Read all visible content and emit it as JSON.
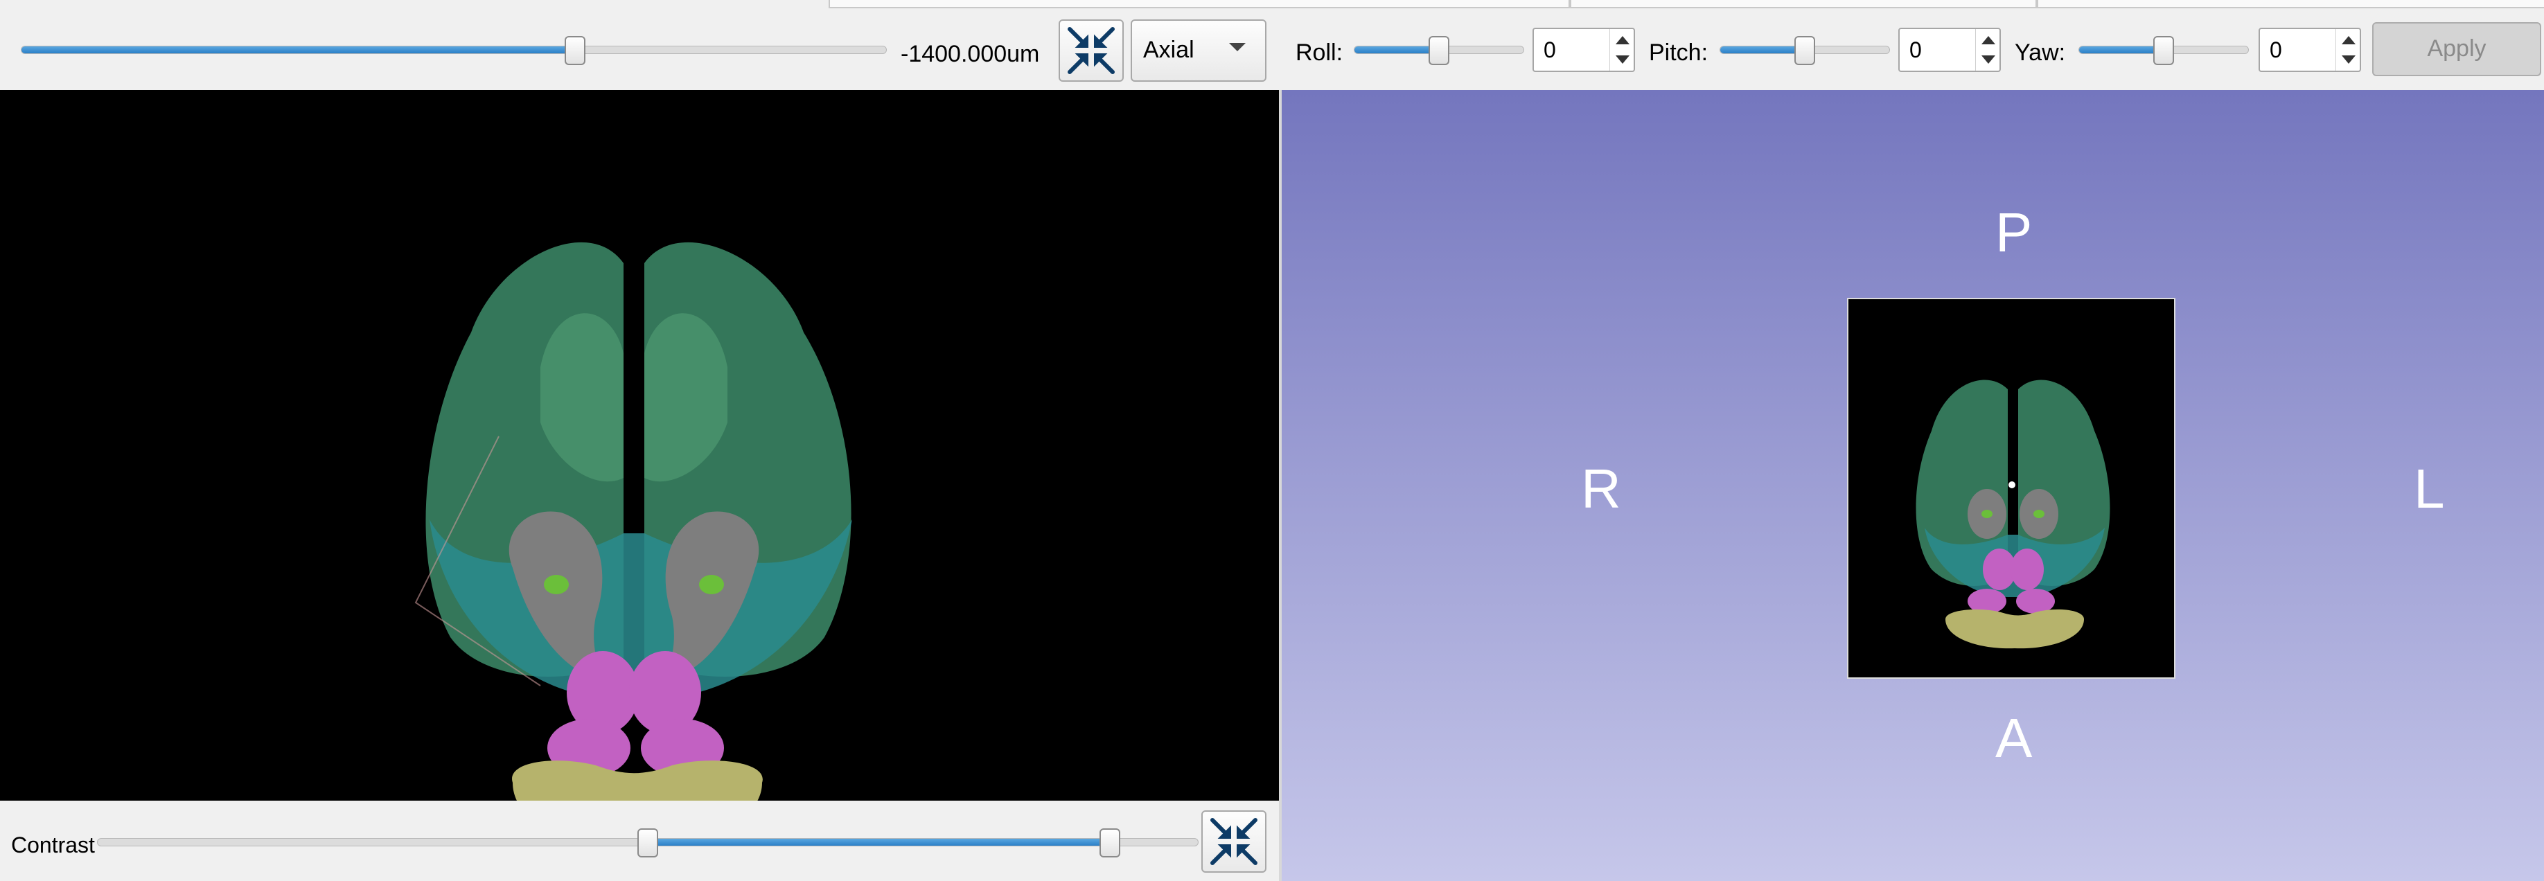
{
  "toolbar": {
    "offset_value": "-1400.000um",
    "offset_fraction": 0.64,
    "orientation": {
      "selected": "Axial"
    },
    "roll": {
      "label": "Roll:",
      "value": "0",
      "fraction": 0.5
    },
    "pitch": {
      "label": "Pitch:",
      "value": "0",
      "fraction": 0.5
    },
    "yaw": {
      "label": "Yaw:",
      "value": "0",
      "fraction": 0.5
    },
    "apply_label": "Apply"
  },
  "view3d": {
    "labels": {
      "top": "P",
      "bottom": "A",
      "left": "R",
      "right": "L"
    },
    "background_top": "#7476be",
    "background_bottom": "#c6c7ea"
  },
  "contrast": {
    "label": "Contrast",
    "range_low": 0.5,
    "range_high": 0.92
  },
  "icons": {
    "fit": "collapse-arrows-icon",
    "dropdown": "chevron-down-icon"
  },
  "colors": {
    "slider_fill": "#2b7fc7",
    "region_green": "#4e9a6a",
    "region_teal": "#2f8c8c",
    "region_magenta": "#c261c2",
    "region_yellow": "#b8b870",
    "region_gray": "#8a8a8a"
  }
}
